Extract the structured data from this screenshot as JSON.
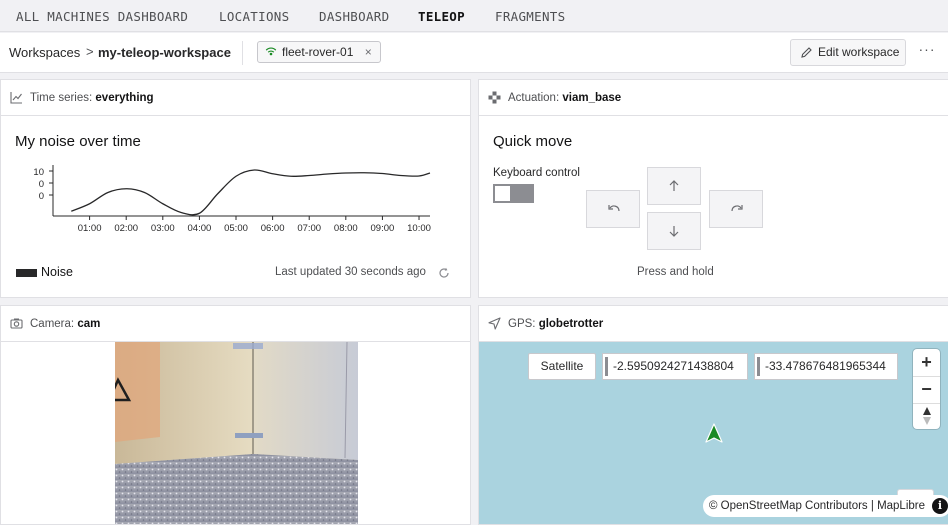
{
  "nav": {
    "items": [
      "ALL MACHINES DASHBOARD",
      "LOCATIONS",
      "DASHBOARD",
      "TELEOP",
      "FRAGMENTS"
    ],
    "active": "TELEOP"
  },
  "workspace_bar": {
    "breadcrumb_root": "Workspaces",
    "separator": ">",
    "breadcrumb_current": "my-teleop-workspace",
    "machine_chip": "fleet-rover-01",
    "chip_close": "×",
    "edit_button": "Edit workspace",
    "more_button": "···",
    "icons": {
      "chip": "signal-icon",
      "edit": "pencil-icon",
      "more": "ellipsis-icon"
    }
  },
  "timeseries": {
    "header_prefix": "Time series:",
    "header_name": "everything",
    "chart_title": "My noise over time",
    "legend": "Noise",
    "last_updated": "Last updated 30 seconds ago",
    "icons": {
      "header": "line-chart-icon",
      "refresh": "refresh-icon"
    }
  },
  "chart_data": {
    "type": "line",
    "x_tick_labels": [
      "01:00",
      "02:00",
      "03:00",
      "04:00",
      "05:00",
      "06:00",
      "07:00",
      "08:00",
      "09:00",
      "10:00"
    ],
    "y_tick_labels": [
      "10",
      "0",
      "0"
    ],
    "ylim": [
      -8,
      12
    ],
    "series": [
      {
        "name": "Noise",
        "color": "#282829",
        "points": [
          [
            0.5,
            -6.5
          ],
          [
            1.0,
            -3.5
          ],
          [
            1.5,
            1.0
          ],
          [
            2.0,
            2.5
          ],
          [
            2.5,
            1.0
          ],
          [
            3.0,
            -3.5
          ],
          [
            3.5,
            -7.0
          ],
          [
            4.0,
            -7.3
          ],
          [
            4.5,
            0.5
          ],
          [
            5.0,
            7.5
          ],
          [
            5.5,
            10.0
          ],
          [
            6.0,
            8.5
          ],
          [
            6.5,
            7.5
          ],
          [
            7.0,
            7.8
          ],
          [
            7.5,
            8.4
          ],
          [
            8.0,
            8.8
          ],
          [
            8.5,
            8.9
          ],
          [
            9.0,
            8.6
          ],
          [
            9.5,
            7.8
          ],
          [
            10.0,
            7.6
          ],
          [
            10.3,
            8.8
          ]
        ]
      }
    ],
    "grid": false,
    "legend_position": "bottom-left"
  },
  "actuation": {
    "header_prefix": "Actuation:",
    "header_name": "viam_base",
    "title": "Quick move",
    "keyboard_label": "Keyboard control",
    "keyboard_enabled": false,
    "hint": "Press and hold",
    "icons": {
      "header": "gamepad-icon",
      "forward": "arrow-up-icon",
      "backward": "arrow-down-icon",
      "left": "rotate-left-icon",
      "right": "rotate-right-icon"
    }
  },
  "camera": {
    "header_prefix": "Camera:",
    "header_name": "cam",
    "icons": {
      "header": "camera-icon"
    }
  },
  "gps": {
    "header_prefix": "GPS:",
    "header_name": "globetrotter",
    "satellite_button": "Satellite",
    "latitude": "-2.5950924271438804",
    "longitude": "-33.478676481965344",
    "zoom_in": "+",
    "zoom_out": "−",
    "attribution": "© OpenStreetMap Contributors | MapLibre",
    "info": "i",
    "map_water_color": "#aad3df",
    "marker_color": "#1a8a24",
    "icons": {
      "header": "navigation-icon",
      "compass": "compass-icon",
      "locate": "locate-arrow-icon",
      "marker": "location-marker-icon"
    }
  }
}
